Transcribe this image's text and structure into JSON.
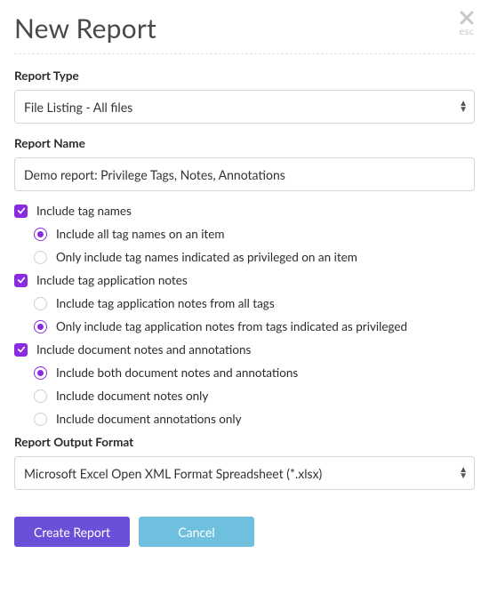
{
  "header": {
    "title": "New Report",
    "close_icon": "✕",
    "esc_label": "esc"
  },
  "report_type": {
    "label": "Report Type",
    "value": "File Listing - All files"
  },
  "report_name": {
    "label": "Report Name",
    "value": "Demo report: Privilege Tags, Notes, Annotations"
  },
  "include_tag_names": {
    "label": "Include tag names",
    "checked": true,
    "options": {
      "all": {
        "label": "Include all tag names on an item",
        "selected": true
      },
      "priv": {
        "label": "Only include tag names indicated as privileged on an item",
        "selected": false
      }
    }
  },
  "include_tag_notes": {
    "label": "Include tag application notes",
    "checked": true,
    "options": {
      "all": {
        "label": "Include tag application notes from all tags",
        "selected": false
      },
      "priv": {
        "label": "Only include tag application notes from tags indicated as privileged",
        "selected": true
      }
    }
  },
  "include_doc_notes": {
    "label": "Include document notes and annotations",
    "checked": true,
    "options": {
      "both": {
        "label": "Include both document notes and annotations",
        "selected": true
      },
      "notes": {
        "label": "Include document notes only",
        "selected": false
      },
      "ann": {
        "label": "Include document annotations only",
        "selected": false
      }
    }
  },
  "output_format": {
    "label": "Report Output Format",
    "value": "Microsoft Excel Open XML Format Spreadsheet (*.xlsx)"
  },
  "buttons": {
    "create": "Create Report",
    "cancel": "Cancel"
  }
}
